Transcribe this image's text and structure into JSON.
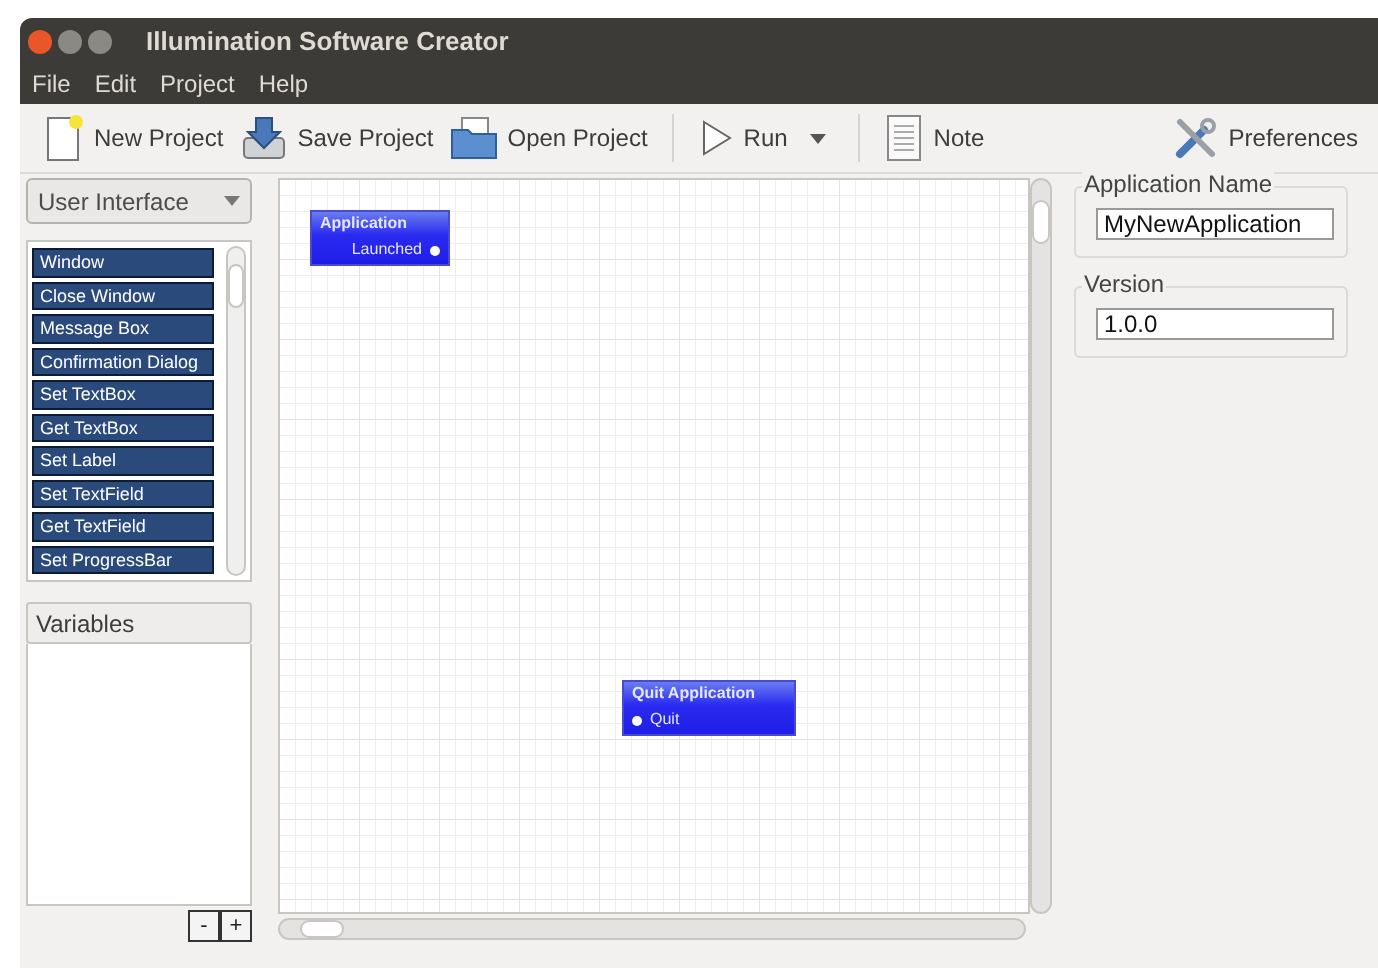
{
  "window": {
    "title": "Illumination Software Creator"
  },
  "menu": [
    "File",
    "Edit",
    "Project",
    "Help"
  ],
  "toolbar": [
    [
      {
        "label": "New Project",
        "has_menu": false
      },
      {
        "label": "Save Project",
        "has_menu": false
      },
      {
        "label": "Open Project",
        "has_menu": false
      }
    ],
    [
      {
        "label": "Run",
        "has_menu": true
      }
    ],
    [
      {
        "label": "Note",
        "has_menu": false
      }
    ]
  ],
  "preferences": {
    "label": "Preferences"
  },
  "palette": {
    "category": "User Interface",
    "items": [
      "Window",
      "Close Window",
      "Message Box",
      "Confirmation Dialog",
      "Set TextBox",
      "Get TextBox",
      "Set Label",
      "Set TextField",
      "Get TextField",
      "Set ProgressBar"
    ]
  },
  "variables": {
    "title": "Variables",
    "buttons": [
      "-",
      "+"
    ]
  },
  "canvas": {
    "nodes": [
      {
        "title": "Application",
        "port": {
          "label": "Launched",
          "kind": "output"
        }
      },
      {
        "title": "Quit Application",
        "port": {
          "label": "Quit",
          "kind": "input"
        }
      }
    ]
  },
  "properties": [
    {
      "label": "Application Name",
      "value": "MyNewApplication"
    },
    {
      "label": "Version",
      "value": "1.0.0"
    }
  ]
}
